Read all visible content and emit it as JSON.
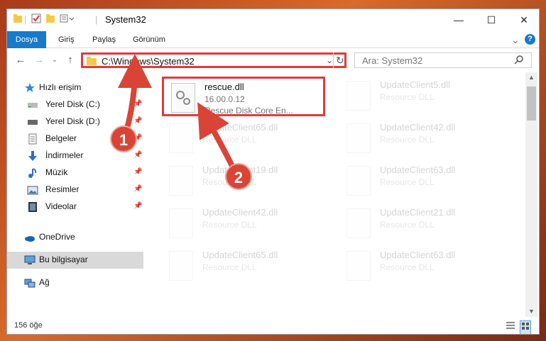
{
  "window": {
    "title": "System32",
    "minimize": "—",
    "maximize": "☐",
    "close": "✕"
  },
  "ribbon": {
    "tabs": [
      "Dosya",
      "Giriş",
      "Paylaş",
      "Görünüm"
    ],
    "collapse_icon": "⌄",
    "help_icon": "?"
  },
  "address": {
    "path": "C:\\Windows\\System32",
    "search_placeholder": "Ara: System32"
  },
  "nav": {
    "quick_access": "Hızlı erişim",
    "items": [
      {
        "label": "Yerel Disk (C:)",
        "icon": "drive-icon"
      },
      {
        "label": "Yerel Disk (D:)",
        "icon": "drive-icon"
      },
      {
        "label": "Belgeler",
        "icon": "documents-icon"
      },
      {
        "label": "İndirmeler",
        "icon": "downloads-icon"
      },
      {
        "label": "Müzik",
        "icon": "music-icon"
      },
      {
        "label": "Resimler",
        "icon": "pictures-icon"
      },
      {
        "label": "Videolar",
        "icon": "videos-icon"
      }
    ],
    "onedrive": "OneDrive",
    "this_pc": "Bu bilgisayar",
    "network": "Ağ"
  },
  "files": [
    {
      "name": "rescue.dll",
      "line1": "16.00.0.12",
      "line2": "Rescue Disk Core En..."
    },
    {
      "name": "UpdateClient5.dll",
      "line1": "Resource DLL",
      "line2": ""
    },
    {
      "name": "UpdateClient65.dll",
      "line1": "Resource DLL",
      "line2": ""
    },
    {
      "name": "UpdateClient42.dll",
      "line1": "Resource DLL",
      "line2": ""
    },
    {
      "name": "UpdateClient19.dll",
      "line1": "Resource DLL",
      "line2": ""
    },
    {
      "name": "UpdateClient63.dll",
      "line1": "Resource DLL",
      "line2": ""
    },
    {
      "name": "UpdateClient42.dll",
      "line1": "Resource DLL",
      "line2": ""
    },
    {
      "name": "UpdateClient21.dll",
      "line1": "Resource DLL",
      "line2": ""
    },
    {
      "name": "UpdateClient65.dll",
      "line1": "Resource DLL",
      "line2": ""
    },
    {
      "name": "UpdateClient63.dll",
      "line1": "Resource DLL",
      "line2": ""
    }
  ],
  "status": {
    "count": "156 öğe"
  },
  "annotations": {
    "step1": "1",
    "step2": "2",
    "highlight_color": "#e03b3b"
  }
}
